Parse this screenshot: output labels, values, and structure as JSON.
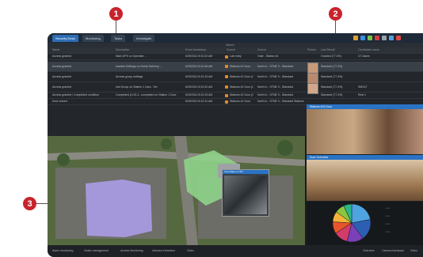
{
  "callouts": [
    "1",
    "2",
    "3"
  ],
  "tabs": [
    "Security Desk",
    "Monitoring",
    "Tasks",
    "Investigate"
  ],
  "subbar_label": "Alarms",
  "grid": {
    "headers": [
      "Name",
      "Description",
      "Event timestamp",
      "Source",
      "Source",
      "Picture",
      "Last Result",
      "Cardholder name"
    ],
    "rows": [
      [
        "Access granted",
        "Main GPS on Operator ...",
        "6/29/2012 8:31:02 AM",
        "Lab entry",
        "Gate - Station #1",
        "",
        "Granted (77.4%)",
        "LTI Alarm"
      ],
      [
        "Access granted",
        "Inactive Settings on Greek Delivery ...",
        "6/29/2012 8:31:06 AM",
        "Stations #1 Door",
        "North In - STNE 0 - Standard",
        "",
        "Standard (77.4%)",
        ""
      ],
      [
        "Access granted",
        "Access group settings",
        "6/29/2012 8:31:15 AM",
        "Stations #1 Door (Clear)",
        "North In - STNE 0 - Standard",
        "",
        "Standard (77.4%)",
        ""
      ],
      [
        "Access granted",
        "Inst Group on Station 1 Cam...Tex",
        "6/29/2012 8:31:20 AM",
        "Stations #1 Door (Clear)",
        "North In - STNE 0 - Standard",
        "",
        "Standard (77.4%)",
        "SMOLT"
      ],
      [
        "Access granted / Completed condition",
        "Completed (LOG.1...completed on Station 1 Door",
        "6/29/2012 8:31:25 AM",
        "Stations #1 Door (Clear)",
        "North In - STNE 0 - Standard",
        "",
        "Standard (77.4%)",
        "Rest 1"
      ],
      [
        "Door closed",
        "",
        "6/29/2012 8:31:31 AM",
        "Stations #1 Door",
        "North In - STNE 0 - Standard Stations",
        "",
        "",
        ""
      ]
    ]
  },
  "map": {
    "label": "Cam Maps on 5th"
  },
  "cameras": [
    {
      "label": "Stations #01 Door"
    },
    {
      "label": "Door Overview"
    }
  ],
  "chart_data": {
    "type": "pie",
    "values": [
      22,
      18,
      14,
      12,
      10,
      9,
      8,
      7
    ],
    "colors": [
      "#4fa3e0",
      "#2c5fb3",
      "#7b3fb8",
      "#d23c6a",
      "#e8542c",
      "#f2b437",
      "#8cc63f",
      "#2bb58a"
    ]
  },
  "status": [
    "Alarm monitoring",
    "Visitor management",
    "Access Monitoring",
    "Intrusion Detection",
    "Video"
  ],
  "status_right": [
    "Overview",
    "Camera hardware",
    "Video"
  ],
  "colors": {
    "frame": "#1b1d20",
    "accent": "#2e6db5",
    "callout": "#c8232c",
    "hull": "#a89ae0",
    "green_building": "#8fd38a"
  }
}
